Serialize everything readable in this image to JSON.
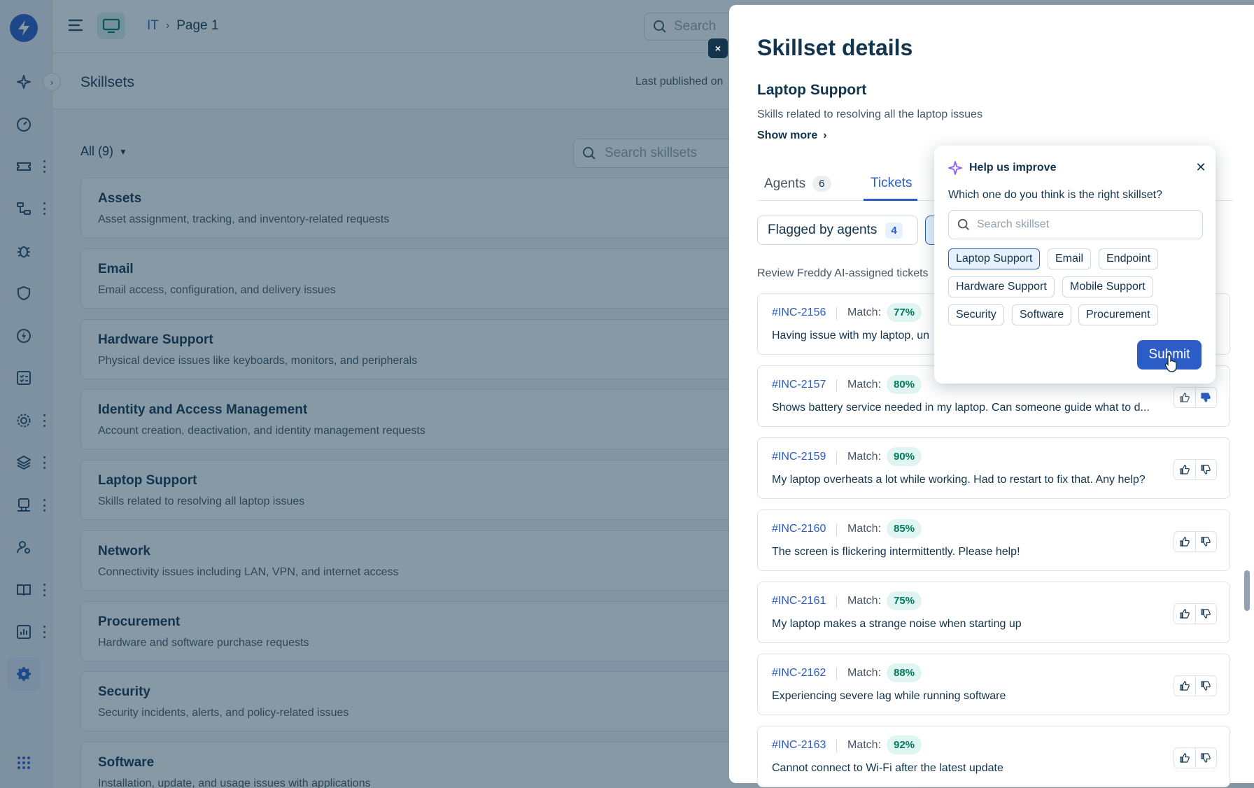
{
  "topbar": {
    "breadcrumb": [
      "IT",
      "Page 1"
    ],
    "search_placeholder": "Search"
  },
  "page": {
    "title": "Skillsets",
    "published_text": "Last published on",
    "filter_label": "All (9)",
    "search_placeholder": "Search skillsets"
  },
  "skillsets": [
    {
      "name": "Assets",
      "description": "Asset assignment, tracking, and inventory-related requests"
    },
    {
      "name": "Email",
      "description": "Email access, configuration, and delivery issues"
    },
    {
      "name": "Hardware Support",
      "description": "Physical device issues like keyboards, monitors, and peripherals"
    },
    {
      "name": "Identity and Access Management",
      "description": "Account creation, deactivation, and identity management requests"
    },
    {
      "name": "Laptop Support",
      "description": "Skills related to resolving all laptop issues"
    },
    {
      "name": "Network",
      "description": "Connectivity issues including LAN, VPN, and internet access"
    },
    {
      "name": "Procurement",
      "description": "Hardware and software purchase requests"
    },
    {
      "name": "Security",
      "description": "Security incidents, alerts, and policy-related issues"
    },
    {
      "name": "Software",
      "description": "Installation, update, and usage issues with applications"
    }
  ],
  "drawer": {
    "title": "Skillset details",
    "skill_name": "Laptop Support",
    "skill_desc": "Skills related to resolving all the laptop issues",
    "show_more": "Show more",
    "close": "×",
    "tabs": [
      {
        "label": "Agents",
        "count": "6"
      },
      {
        "label": "Tickets"
      }
    ],
    "flagged_label": "Flagged by agents",
    "flagged_count": "4",
    "review_text": "Review Freddy AI-assigned tickets",
    "match_label": "Match:",
    "tickets": [
      {
        "id": "#INC-2156",
        "match": "77%",
        "text": "Having issue with my laptop, un"
      },
      {
        "id": "#INC-2157",
        "match": "80%",
        "text": "Shows battery service needed in my laptop. Can someone guide what to d..."
      },
      {
        "id": "#INC-2159",
        "match": "90%",
        "text": "My laptop overheats a lot while working. Had to restart to fix that. Any help?"
      },
      {
        "id": "#INC-2160",
        "match": "85%",
        "text": "The screen is flickering intermittently. Please help!"
      },
      {
        "id": "#INC-2161",
        "match": "75%",
        "text": "My laptop makes a strange noise when starting up"
      },
      {
        "id": "#INC-2162",
        "match": "88%",
        "text": "Experiencing severe lag while running software"
      },
      {
        "id": "#INC-2163",
        "match": "92%",
        "text": "Cannot connect to Wi-Fi after the latest update"
      }
    ]
  },
  "popover": {
    "title": "Help us improve",
    "question": "Which one do you think is the right skillset?",
    "search_placeholder": "Search skillset",
    "options": [
      "Laptop Support",
      "Email",
      "Endpoint",
      "Hardware Support",
      "Mobile Support",
      "Security",
      "Software",
      "Procurement"
    ],
    "selected": "Laptop Support",
    "submit_label": "Submit",
    "close": "✕"
  },
  "colors": {
    "accent": "#2c5cc5",
    "brand_logo": "#2c5cc5",
    "match_green": "#00795b",
    "thumbs_down_active": "#2c5cc5",
    "sparkle": "#8b5cf6"
  }
}
